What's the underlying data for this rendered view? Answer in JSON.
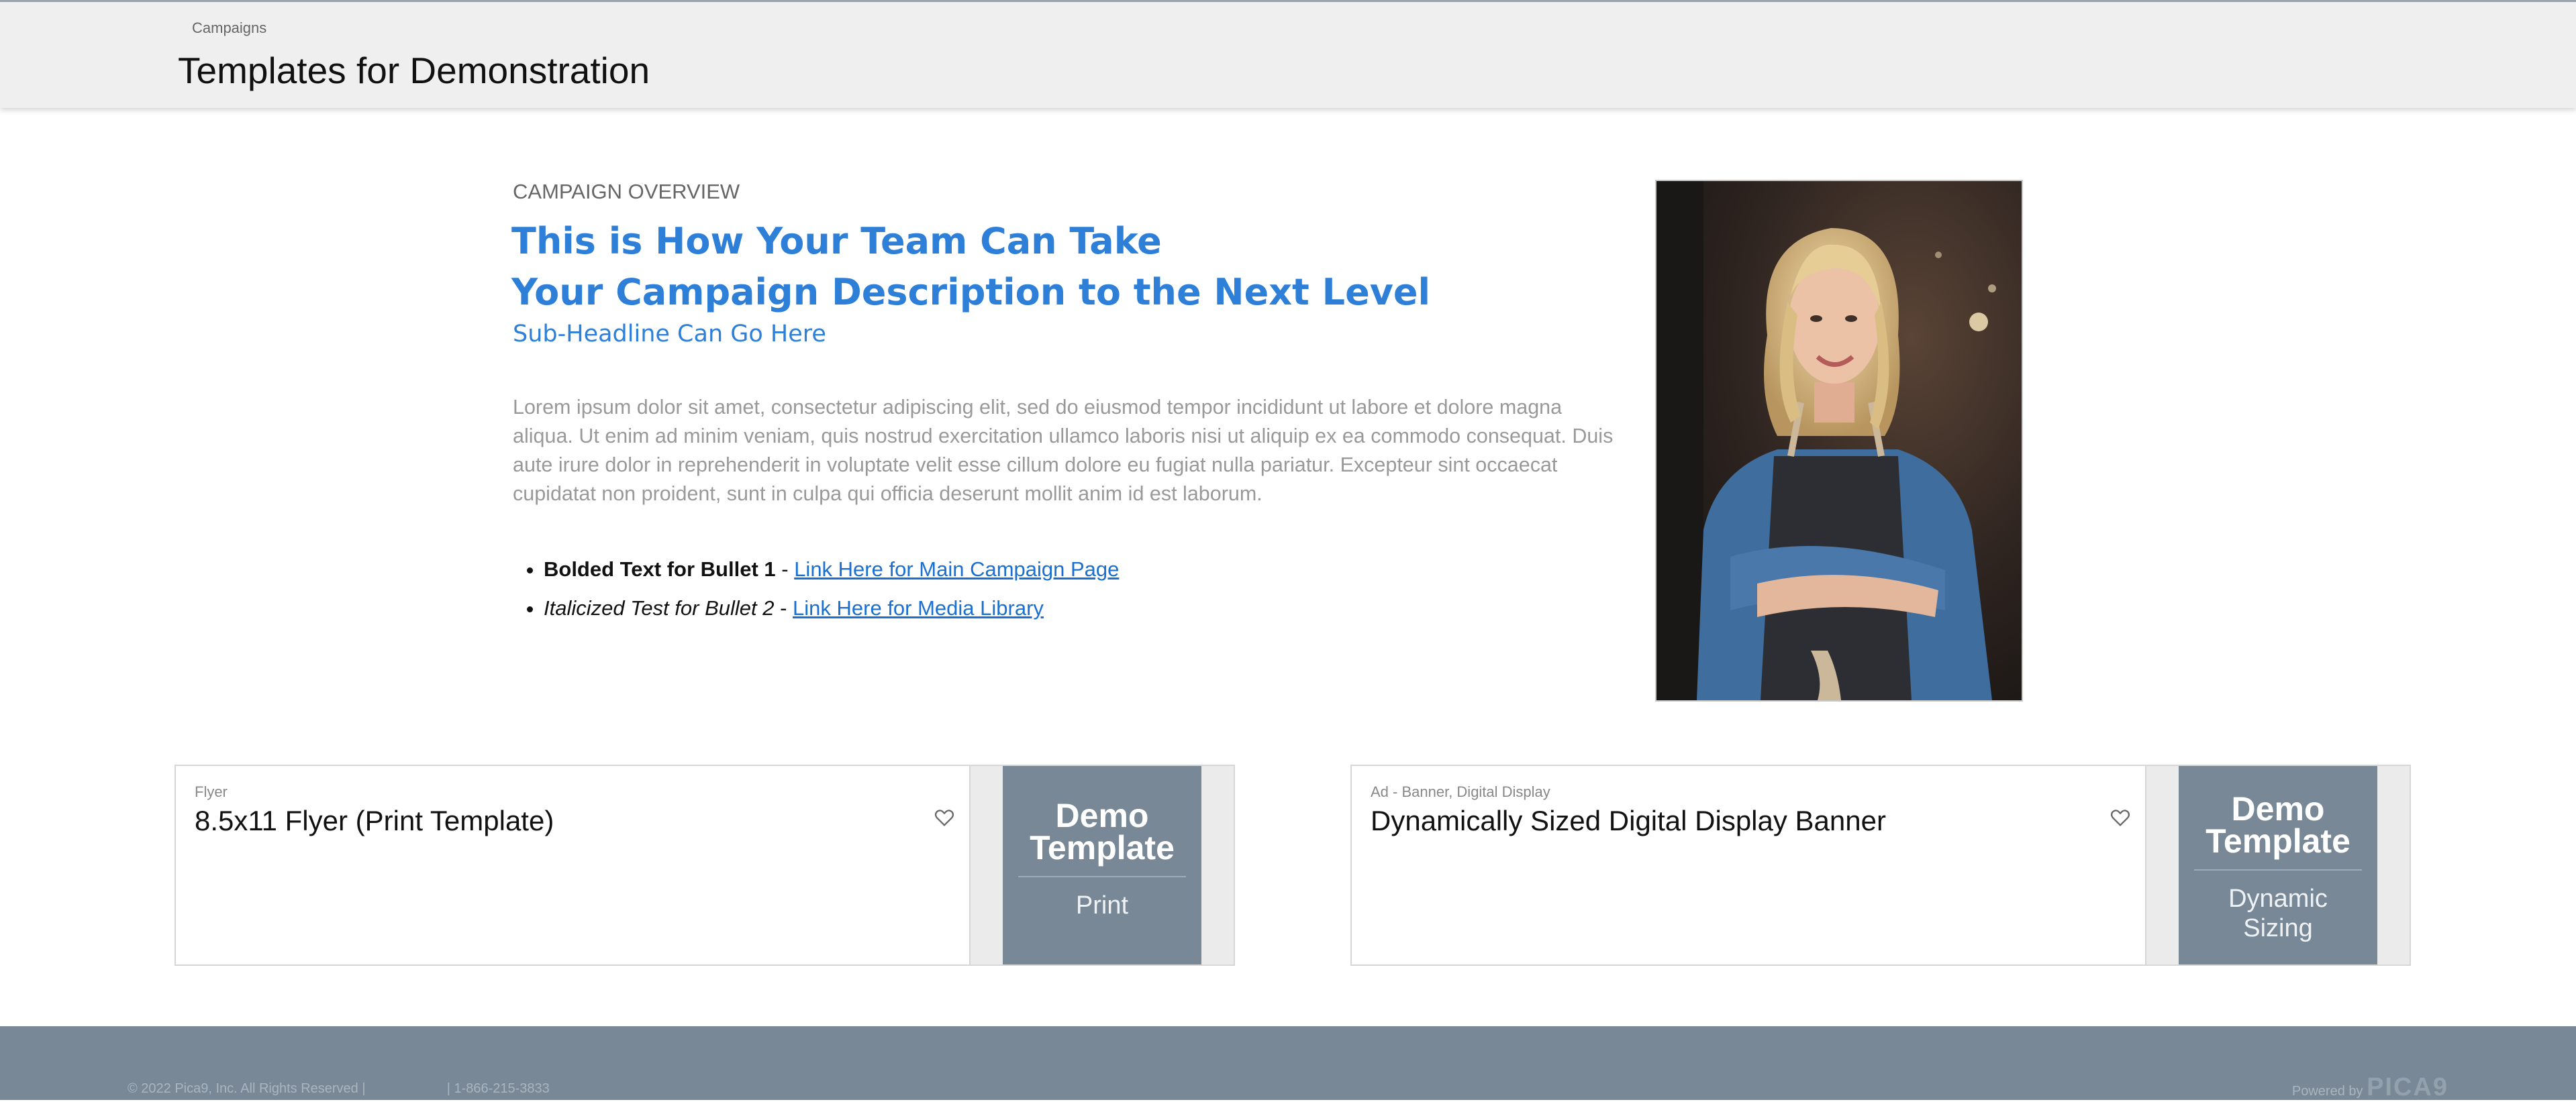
{
  "header": {
    "breadcrumb": "Campaigns",
    "title": "Templates for Demonstration"
  },
  "overview": {
    "label": "CAMPAIGN OVERVIEW",
    "headline_line1": "This is How Your Team Can Take",
    "headline_line2": "Your Campaign Description to the Next Level",
    "subheadline": "Sub-Headline Can Go Here",
    "body": "Lorem ipsum dolor sit amet, consectetur adipiscing elit, sed do eiusmod tempor incididunt ut labore et dolore magna aliqua. Ut enim ad minim veniam, quis nostrud exercitation ullamco laboris nisi ut aliquip ex ea commodo consequat. Duis aute irure dolor in reprehenderit in voluptate velit esse cillum dolore eu fugiat nulla pariatur. Excepteur sint occaecat cupidatat non proident, sunt in culpa qui officia deserunt mollit anim id est laborum.",
    "bullets": [
      {
        "lead": "Bolded Text for Bullet 1",
        "sep": " - ",
        "link": "Link Here for Main Campaign Page"
      },
      {
        "lead": "Italicized Test for Bullet 2",
        "sep": " - ",
        "link": "Link Here for Media Library"
      }
    ]
  },
  "cards": [
    {
      "type": "Flyer",
      "name": "8.5x11 Flyer (Print Template)",
      "thumb_line1": "Demo",
      "thumb_line2": "Template",
      "thumb_sub": "Print",
      "favorite_icon": "heart-icon"
    },
    {
      "type": "Ad - Banner, Digital Display",
      "name": "Dynamically Sized Digital Display Banner",
      "thumb_line1": "Demo",
      "thumb_line2": "Template",
      "thumb_sub_line1": "Dynamic",
      "thumb_sub_line2": "Sizing",
      "favorite_icon": "heart-icon"
    }
  ],
  "footer": {
    "copyright": "© 2022 Pica9, Inc. All Rights Reserved |",
    "phone": "| 1-866-215-3833",
    "powered_by": "Powered by",
    "brand": "PICA9"
  },
  "colors": {
    "accent": "#2e7fd8",
    "link": "#1a6fd0",
    "thumb": "#788896",
    "footer": "#788896",
    "header": "#efefef"
  }
}
